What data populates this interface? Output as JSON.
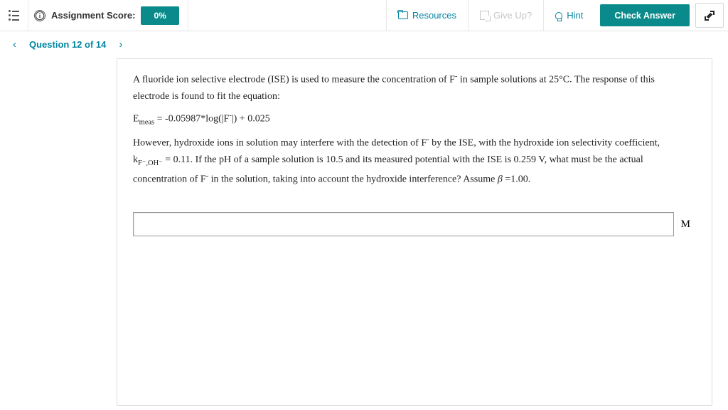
{
  "header": {
    "score_label": "Assignment Score:",
    "score_value": "0%",
    "resources": "Resources",
    "give_up": "Give Up?",
    "hint": "Hint",
    "check_answer": "Check Answer"
  },
  "nav": {
    "question_label": "Question 12 of 14"
  },
  "question": {
    "para1_a": "A fluoride ion selective electrode (ISE) is used to measure the concentration of F",
    "para1_b": " in sample solutions at 25°C.  The response of this electrode is found to fit the equation:",
    "eq_lhs": "E",
    "eq_sub": "meas",
    "eq_rhs": " = -0.05987*log(|F",
    "eq_rhs2": "|) + 0.025",
    "para2_a": "However, hydroxide ions in solution may interfere with the detection of F",
    "para2_b": " by the ISE, with the hydroxide ion selectivity coefficient, k",
    "para2_sub": "F⁻,OH⁻",
    "para2_c": " = 0.11.   If the pH of a sample solution is 10.5 and its measured potential with the ISE is 0.259 V, what must be the actual concentration of F",
    "para2_d": " in the solution, taking into account the hydroxide interference?  Assume ",
    "beta": "β",
    "para2_e": " =1.00.",
    "unit": "M"
  }
}
